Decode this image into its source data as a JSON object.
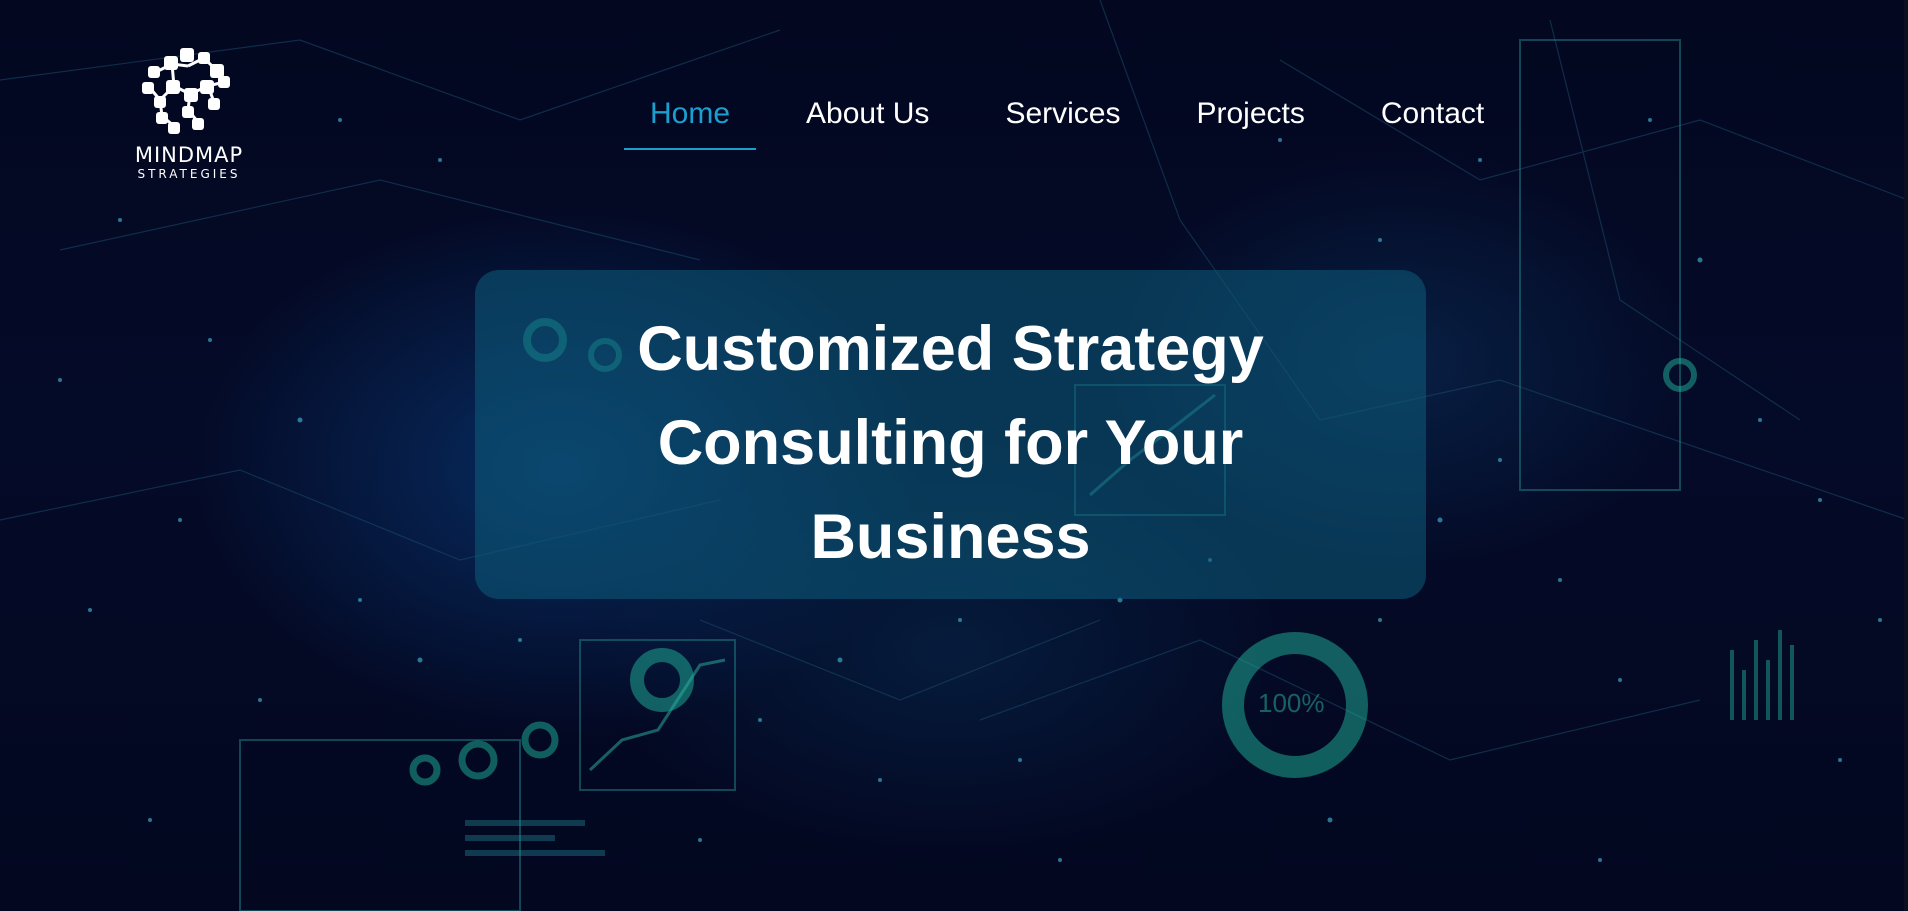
{
  "logo": {
    "name": "MINDMAP",
    "tagline": "STRATEGIES",
    "icon": "circuit-mindmap-icon"
  },
  "nav": {
    "items": [
      {
        "label": "Home",
        "active": true
      },
      {
        "label": "About Us",
        "active": false
      },
      {
        "label": "Services",
        "active": false
      },
      {
        "label": "Projects",
        "active": false
      },
      {
        "label": "Contact",
        "active": false
      }
    ],
    "active_color": "#1b9fcf",
    "text_color": "#ffffff"
  },
  "hero": {
    "title": "Customized Strategy Consulting for Your Business",
    "card_color": "#0c5c7c"
  },
  "background": {
    "decor_label": "100%"
  }
}
